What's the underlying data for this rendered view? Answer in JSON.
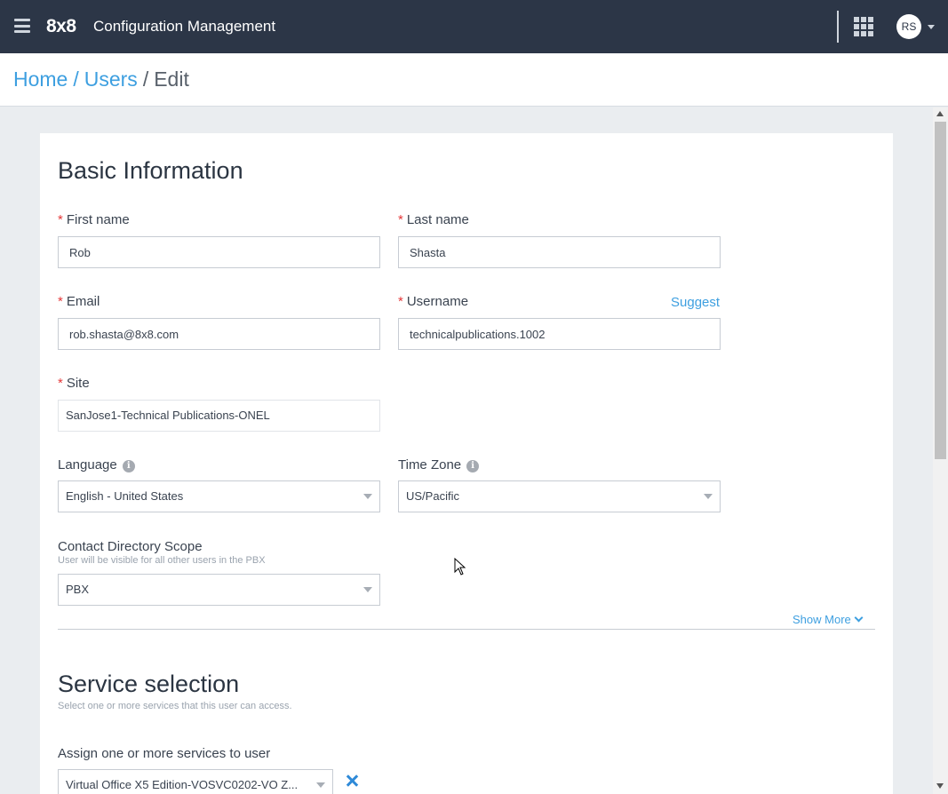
{
  "header": {
    "brand": "8x8",
    "app_title": "Configuration Management",
    "avatar_initials": "RS",
    "colors": {
      "bar": "#2c3647",
      "accent": "#3d9fe0"
    }
  },
  "breadcrumb": {
    "home": "Home",
    "users": "Users",
    "current": "Edit",
    "separator": "/"
  },
  "basic_info": {
    "title": "Basic Information",
    "first_name": {
      "label": "First name",
      "value": "Rob"
    },
    "last_name": {
      "label": "Last name",
      "value": "Shasta"
    },
    "email": {
      "label": "Email",
      "value": "rob.shasta@8x8.com"
    },
    "username": {
      "label": "Username",
      "value": "technicalpublications.1002",
      "suggest_label": "Suggest"
    },
    "site": {
      "label": "Site",
      "value": "SanJose1-Technical Publications-ONEL"
    },
    "language": {
      "label": "Language",
      "value": "English - United States"
    },
    "time_zone": {
      "label": "Time Zone",
      "value": "US/Pacific"
    },
    "contact_scope": {
      "label": "Contact Directory Scope",
      "hint": "User will be visible for all other users in the PBX",
      "value": "PBX"
    },
    "show_more_label": "Show More",
    "required_marker": "*",
    "info_glyph": "i"
  },
  "service_selection": {
    "title": "Service selection",
    "subtitle": "Select one or more services that this user can access.",
    "assign_label": "Assign one or more services to user",
    "selected_service": "Virtual Office X5 Edition-VOSVC0202-VO Z..."
  }
}
